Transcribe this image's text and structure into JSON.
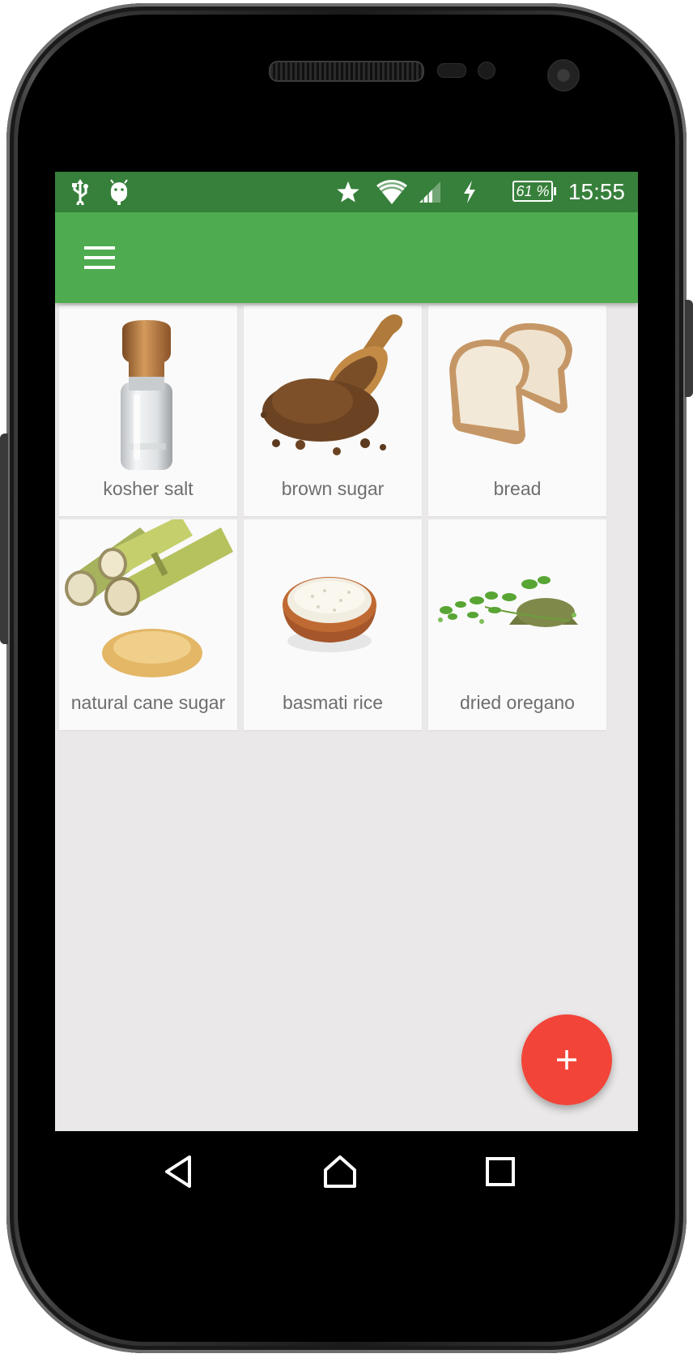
{
  "status_bar": {
    "battery": "61 %",
    "time": "15:55",
    "icons": [
      "usb-icon",
      "android-debug-icon",
      "star-icon",
      "wifi-icon",
      "signal-icon",
      "charging-icon",
      "battery-icon"
    ]
  },
  "app_bar": {
    "menu_icon": "hamburger-menu-icon"
  },
  "items": [
    {
      "label": "kosher salt"
    },
    {
      "label": "brown sugar"
    },
    {
      "label": "bread"
    },
    {
      "label": "natural cane sugar"
    },
    {
      "label": "basmati rice"
    },
    {
      "label": "dried oregano"
    }
  ],
  "fab": {
    "icon": "plus-icon"
  },
  "nav_bar": {
    "icons": [
      "back-icon",
      "home-icon",
      "recents-icon"
    ]
  },
  "colors": {
    "status_bar": "#37803b",
    "app_bar": "#4fab4f",
    "fab": "#f24438",
    "background": "#eae8e8"
  }
}
